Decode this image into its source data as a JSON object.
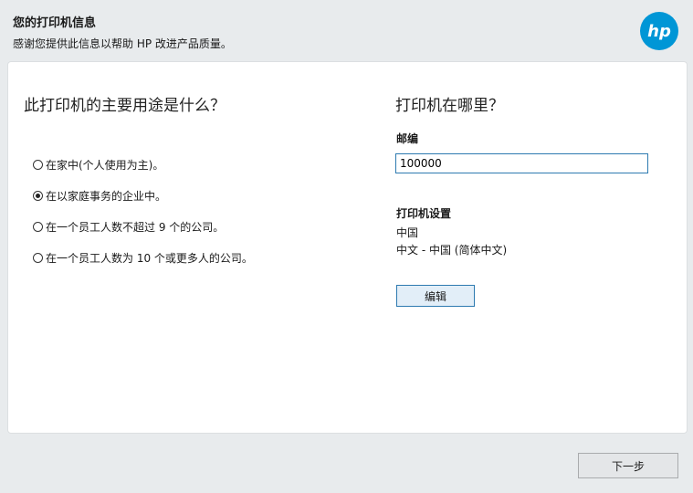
{
  "header": {
    "title": "您的打印机信息",
    "subtitle": "感谢您提供此信息以帮助 HP 改进产品质量。",
    "logo_text": "hp"
  },
  "usage": {
    "heading": "此打印机的主要用途是什么？",
    "options": [
      {
        "label": "在家中(个人使用为主)。",
        "selected": false
      },
      {
        "label": "在以家庭事务的企业中。",
        "selected": true
      },
      {
        "label": "在一个员工人数不超过 9 个的公司。",
        "selected": false
      },
      {
        "label": "在一个员工人数为 10 个或更多人的公司。",
        "selected": false
      }
    ]
  },
  "location": {
    "heading": "打印机在哪里？",
    "zip_label": "邮编",
    "zip_value": "100000",
    "settings_title": "打印机设置",
    "country": "中国",
    "language": "中文 - 中国 (简体中文)",
    "edit_label": "编辑"
  },
  "footer": {
    "next_label": "下一步"
  },
  "colors": {
    "brand": "#0096d6",
    "focus_border": "#2d7ab0"
  }
}
